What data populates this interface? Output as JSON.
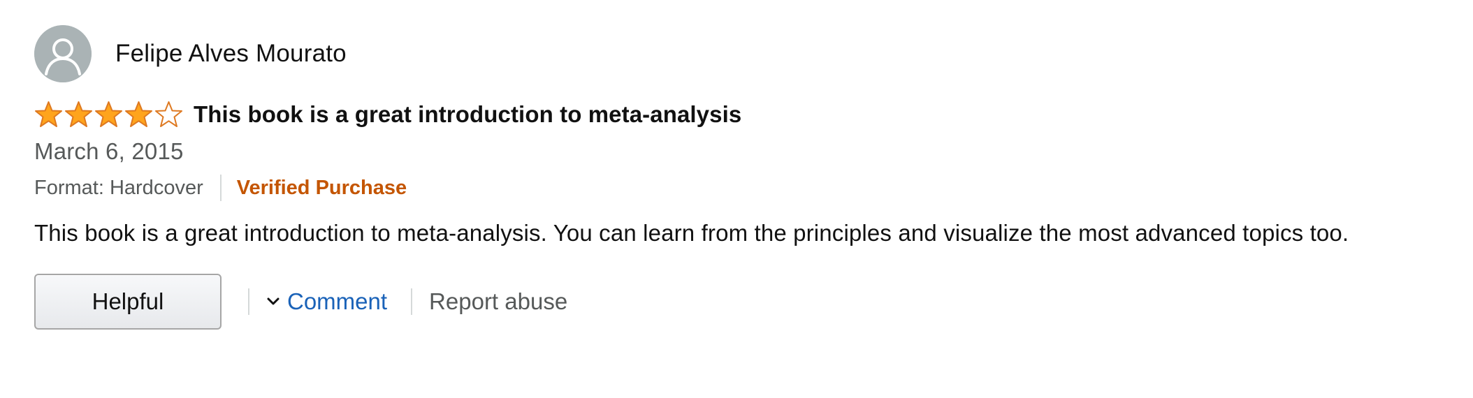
{
  "reviewer": {
    "name": "Felipe Alves Mourato",
    "avatar_icon": "default-profile-icon"
  },
  "review": {
    "rating": 4,
    "rating_max": 5,
    "title": "This book is a great introduction to meta-analysis",
    "date": "March 6, 2015",
    "format": "Format: Hardcover",
    "verified": "Verified Purchase",
    "body": "This book is a great introduction to meta-analysis. You can learn from the principles and visualize the most advanced topics too."
  },
  "actions": {
    "helpful_label": "Helpful",
    "comment_label": "Comment",
    "comment_icon": "chevron-down-icon",
    "report_label": "Report abuse"
  },
  "colors": {
    "star_fill": "#ffa41c",
    "star_outline": "#de7921",
    "verified": "#c45500",
    "link": "#1a62b8",
    "muted": "#565959",
    "avatar_bg": "#aab3b5"
  }
}
